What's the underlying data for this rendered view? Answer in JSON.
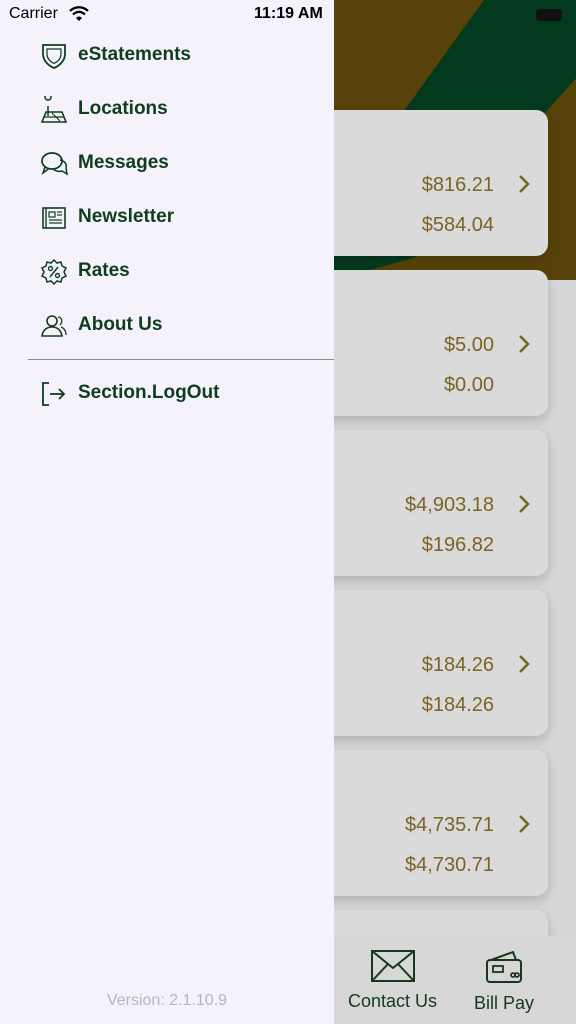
{
  "status_bar": {
    "carrier": "Carrier",
    "time": "11:19 AM"
  },
  "menu": {
    "items": [
      {
        "label": "eStatements",
        "icon": "shield-icon"
      },
      {
        "label": "Locations",
        "icon": "map-icon"
      },
      {
        "label": "Messages",
        "icon": "chat-bubbles-icon"
      },
      {
        "label": "Newsletter",
        "icon": "newspaper-icon"
      },
      {
        "label": "Rates",
        "icon": "percent-badge-icon"
      },
      {
        "label": "About Us",
        "icon": "people-icon"
      }
    ],
    "logout": {
      "label": "Section.LogOut",
      "icon": "logout-icon"
    }
  },
  "version": "Version: 2.1.10.9",
  "accounts": [
    {
      "amount_1": "$816.21",
      "amount_2": "$584.04"
    },
    {
      "amount_1": "$5.00",
      "amount_2": "$0.00"
    },
    {
      "amount_1": "$4,903.18",
      "amount_2": "$196.82"
    },
    {
      "amount_1": "$184.26",
      "amount_2": "$184.26"
    },
    {
      "amount_1": "$4,735.71",
      "amount_2": "$4,730.71"
    }
  ],
  "bottom_tabs": [
    {
      "label": "Contact Us",
      "icon": "envelope-icon"
    },
    {
      "label": "Bill Pay",
      "icon": "wallet-card-icon"
    }
  ],
  "colors": {
    "drawer_bg": "#f5f2fb",
    "menu_text": "#0f3d1f",
    "amount_text": "#7a6325",
    "header_green": "#033a1d",
    "header_gold": "#574309"
  }
}
